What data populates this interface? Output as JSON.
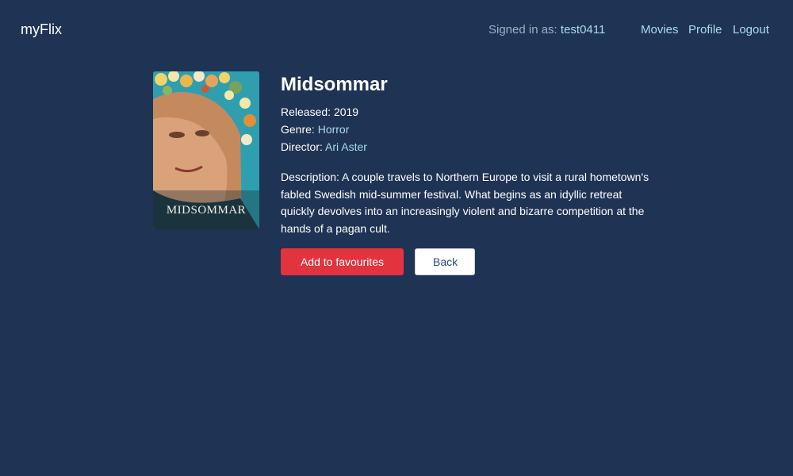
{
  "nav": {
    "brand": "myFlix",
    "signed_in_label": "Signed in as:",
    "username": "test0411",
    "links": [
      "Movies",
      "Profile",
      "Logout"
    ]
  },
  "movie": {
    "poster_title": "MIDSOMMAR",
    "title": "Midsommar",
    "released_label": "Released:",
    "released": "2019",
    "genre_label": "Genre:",
    "genre": "Horror",
    "director_label": "Director:",
    "director": "Ari Aster",
    "description_label": "Description:",
    "description": "A couple travels to Northern Europe to visit a rural hometown's fabled Swedish mid-summer festival. What begins as an idyllic retreat quickly devolves into an increasingly violent and bizarre competition at the hands of a pagan cult."
  },
  "actions": {
    "favourite_label": "Add to favourites",
    "back_label": "Back"
  },
  "colors": {
    "background": "#1f3354",
    "link": "#a9dcec",
    "primary_button": "#e2333f"
  }
}
